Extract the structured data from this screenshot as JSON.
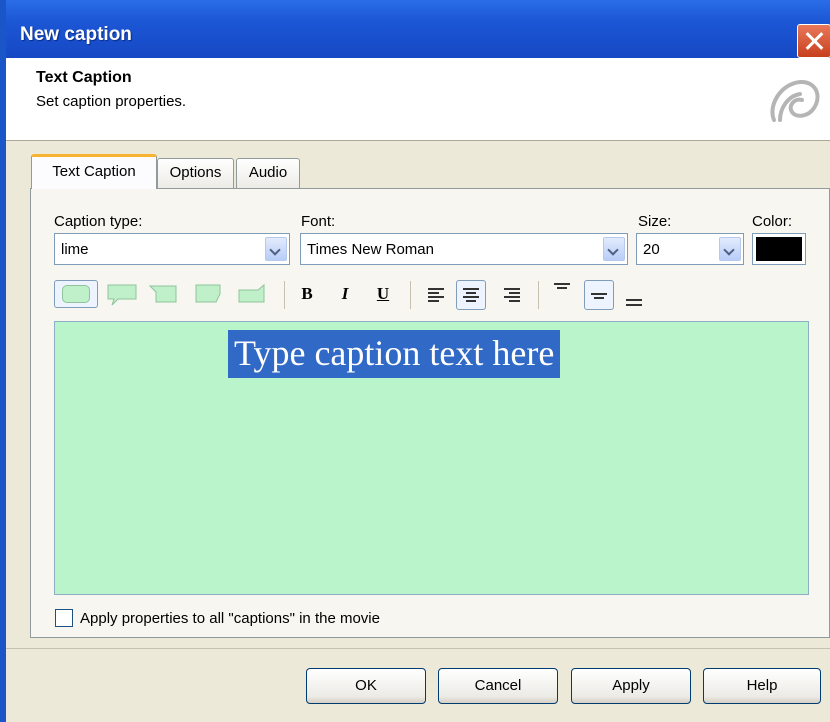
{
  "window": {
    "title": "New caption"
  },
  "header": {
    "title": "Text Caption",
    "subtitle": "Set caption properties."
  },
  "tabs": [
    {
      "label": "Text Caption",
      "active": true
    },
    {
      "label": "Options",
      "active": false
    },
    {
      "label": "Audio",
      "active": false
    }
  ],
  "fields": {
    "caption_type_label": "Caption type:",
    "caption_type_value": "lime",
    "font_label": "Font:",
    "font_value": "Times New Roman",
    "size_label": "Size:",
    "size_value": "20",
    "color_label": "Color:",
    "color_value": "#000000"
  },
  "toolbar": {
    "bold": "B",
    "italic": "I",
    "underline": "U",
    "shape_icons": [
      "rounded-rect-shape-icon",
      "speech-bubble-shape-icon",
      "left-tab-shape-icon",
      "corner-tab-shape-icon",
      "right-tab-shape-icon"
    ],
    "selected_horizontal_align": "center",
    "selected_vertical_align": "middle"
  },
  "editor": {
    "text": "Type caption text here",
    "background": "#b9f4cb",
    "selection": "#3169c6"
  },
  "apply_all": {
    "label": "Apply properties to all \"captions\" in the movie",
    "checked": false
  },
  "buttons": {
    "ok": "OK",
    "cancel": "Cancel",
    "apply": "Apply",
    "help": "Help"
  }
}
